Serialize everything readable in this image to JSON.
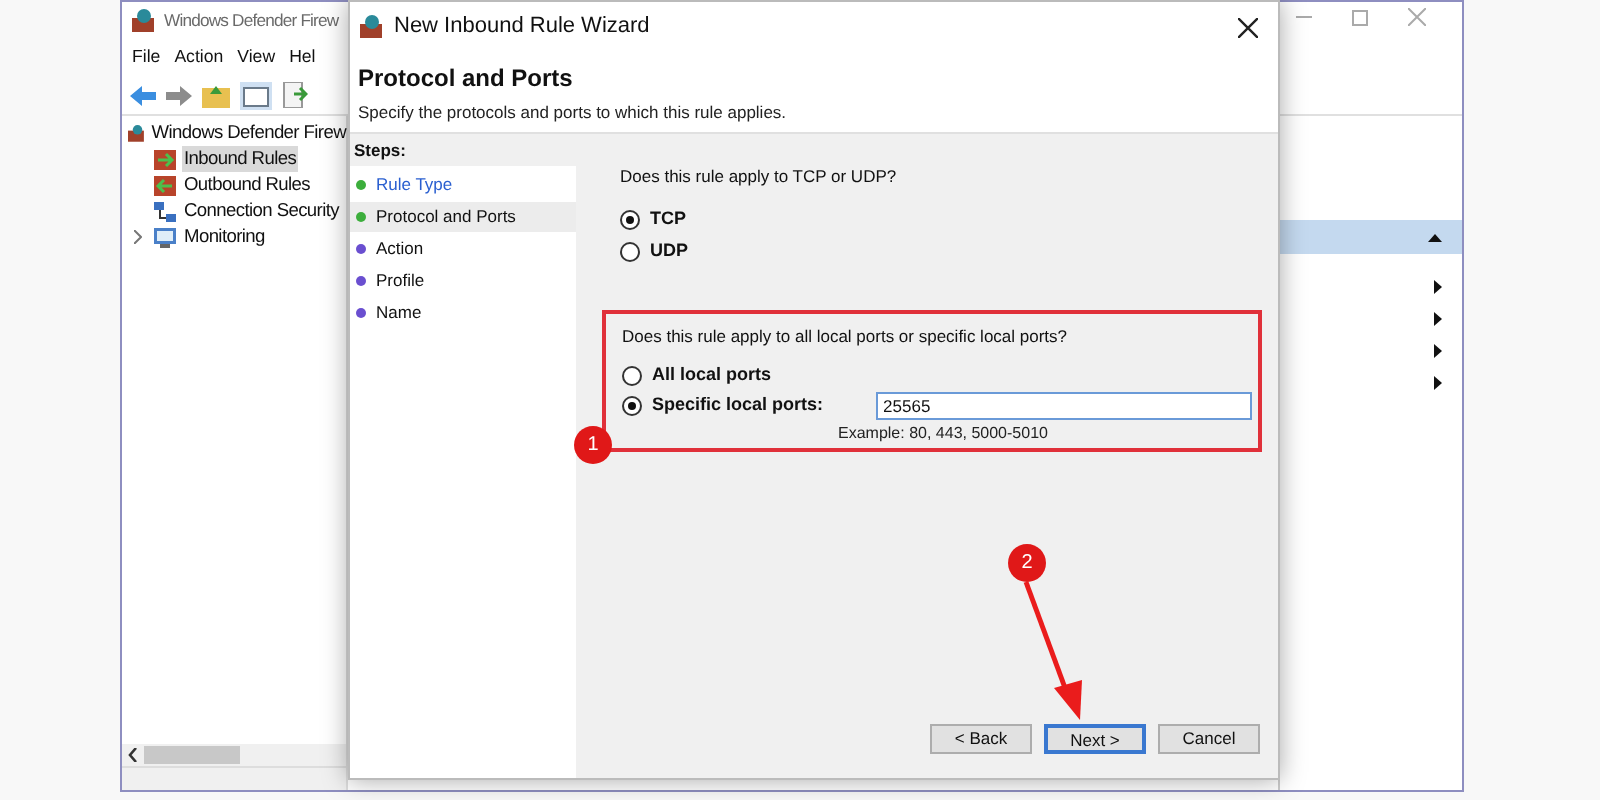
{
  "main_window": {
    "title": "Windows Defender Firew",
    "menu": [
      "File",
      "Action",
      "View",
      "Hel"
    ],
    "tree": [
      {
        "label": "Windows Defender Firew",
        "children": [
          {
            "label": "Inbound Rules",
            "selected": true
          },
          {
            "label": "Outbound Rules",
            "selected": false
          },
          {
            "label": "Connection Security",
            "selected": false
          },
          {
            "label": "Monitoring",
            "selected": false,
            "expanded": false
          }
        ]
      }
    ]
  },
  "wizard": {
    "title": "New Inbound Rule Wizard",
    "heading": "Protocol and Ports",
    "subtitle": "Specify the protocols and ports to which this rule applies.",
    "steps_title": "Steps:",
    "steps": [
      {
        "label": "Rule Type",
        "selected": false,
        "link": true,
        "color": "#3cae3c"
      },
      {
        "label": "Protocol and Ports",
        "selected": true,
        "link": false,
        "color": "#3cae3c"
      },
      {
        "label": "Action",
        "selected": false,
        "link": false,
        "color": "#6a4fd0"
      },
      {
        "label": "Profile",
        "selected": false,
        "link": false,
        "color": "#6a4fd0"
      },
      {
        "label": "Name",
        "selected": false,
        "link": false,
        "color": "#6a4fd0"
      }
    ],
    "protocol_question": "Does this rule apply to TCP or UDP?",
    "protocols": [
      {
        "label": "TCP",
        "selected": true
      },
      {
        "label": "UDP",
        "selected": false
      }
    ],
    "ports_question": "Does this rule apply to all local ports or specific local ports?",
    "port_options": [
      {
        "label": "All local ports",
        "selected": false
      },
      {
        "label": "Specific local ports:",
        "selected": true
      }
    ],
    "ports_field": {
      "value": "25565",
      "hint": "Example: 80, 443, 5000-5010"
    },
    "buttons": [
      {
        "label": "< Back",
        "focused": false
      },
      {
        "label": "Next >",
        "focused": true
      },
      {
        "label": "Cancel",
        "focused": false
      }
    ]
  },
  "callouts": [
    {
      "label": "1"
    },
    {
      "label": "2"
    }
  ]
}
